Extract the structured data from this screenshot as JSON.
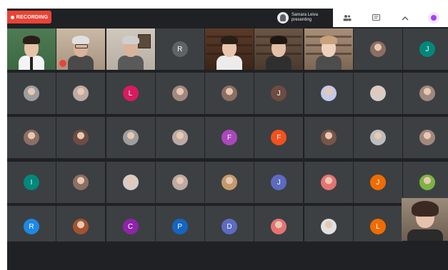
{
  "recording": {
    "label": "RECORDING",
    "color": "#ea4335"
  },
  "presenter": {
    "name": "Samara Leiva",
    "subtitle": "presenting"
  },
  "controls": [
    {
      "icon": "people-icon",
      "glyph": "👥"
    },
    {
      "icon": "chat-icon",
      "glyph": "▤"
    },
    {
      "icon": "chevron-up-icon",
      "glyph": "^"
    },
    {
      "icon": "activities-icon",
      "glyph": ""
    }
  ],
  "grid": {
    "rows": [
      [
        {
          "kind": "video",
          "scene": "green-wall-man"
        },
        {
          "kind": "video",
          "scene": "bookshelf-older-man",
          "muted": true
        },
        {
          "kind": "video",
          "scene": "older-man-wall"
        },
        {
          "kind": "avatar",
          "letter": "R",
          "color": "#5f6368"
        },
        {
          "kind": "video",
          "scene": "bookshelf-man"
        },
        {
          "kind": "video",
          "scene": "woman-bookshelf"
        },
        {
          "kind": "video",
          "scene": "young-man-shelf"
        },
        {
          "kind": "avatar",
          "letter": "",
          "color": "#8d6e63",
          "photo": true
        },
        {
          "kind": "avatar",
          "letter": "J",
          "color": "#00897b"
        }
      ],
      [
        {
          "kind": "avatar",
          "letter": "",
          "color": "#9e9e9e",
          "photo": true
        },
        {
          "kind": "avatar",
          "letter": "",
          "color": "#bcaaa4",
          "photo": true
        },
        {
          "kind": "avatar",
          "letter": "L",
          "color": "#d81b60"
        },
        {
          "kind": "avatar",
          "letter": "",
          "color": "#a1887f",
          "photo": true
        },
        {
          "kind": "avatar",
          "letter": "",
          "color": "#8d6e63",
          "photo": true
        },
        {
          "kind": "avatar",
          "letter": "J",
          "color": "#6d4c41"
        },
        {
          "kind": "avatar",
          "letter": "",
          "color": "#c5cae9",
          "photo": true
        },
        {
          "kind": "avatar",
          "letter": "",
          "color": "#d7ccc8",
          "photo": true
        },
        {
          "kind": "avatar",
          "letter": "",
          "color": "#a1887f",
          "photo": true
        }
      ],
      [
        {
          "kind": "avatar",
          "letter": "",
          "color": "#8d6e63",
          "photo": true
        },
        {
          "kind": "avatar",
          "letter": "",
          "color": "#6d4c41",
          "photo": true
        },
        {
          "kind": "avatar",
          "letter": "",
          "color": "#9e9e9e",
          "photo": true
        },
        {
          "kind": "avatar",
          "letter": "",
          "color": "#bcaaa4",
          "photo": true
        },
        {
          "kind": "avatar",
          "letter": "F",
          "color": "#ab47bc"
        },
        {
          "kind": "avatar",
          "letter": "F",
          "color": "#f4511e"
        },
        {
          "kind": "avatar",
          "letter": "",
          "color": "#795548",
          "photo": true
        },
        {
          "kind": "avatar",
          "letter": "",
          "color": "#bdbdbd",
          "photo": true
        },
        {
          "kind": "avatar",
          "letter": "",
          "color": "#a1887f",
          "photo": true
        }
      ],
      [
        {
          "kind": "avatar",
          "letter": "I",
          "color": "#00897b"
        },
        {
          "kind": "avatar",
          "letter": "",
          "color": "#8d6e63",
          "photo": true
        },
        {
          "kind": "avatar",
          "letter": "",
          "color": "#d7ccc8",
          "photo": true
        },
        {
          "kind": "avatar",
          "letter": "",
          "color": "#bcaaa4",
          "photo": true
        },
        {
          "kind": "avatar",
          "letter": "",
          "color": "#c49a6c",
          "photo": true
        },
        {
          "kind": "avatar",
          "letter": "J",
          "color": "#5c6bc0"
        },
        {
          "kind": "avatar",
          "letter": "",
          "color": "#e57373",
          "photo": true
        },
        {
          "kind": "avatar",
          "letter": "J",
          "color": "#ef6c00"
        },
        {
          "kind": "avatar",
          "letter": "",
          "color": "#7cb342",
          "photo": true
        }
      ],
      [
        {
          "kind": "avatar",
          "letter": "R",
          "color": "#1e88e5"
        },
        {
          "kind": "avatar",
          "letter": "",
          "color": "#a1532f",
          "photo": true
        },
        {
          "kind": "avatar",
          "letter": "C",
          "color": "#8e24aa"
        },
        {
          "kind": "avatar",
          "letter": "P",
          "color": "#1565c0"
        },
        {
          "kind": "avatar",
          "letter": "D",
          "color": "#5c6bc0"
        },
        {
          "kind": "avatar",
          "letter": "",
          "color": "#e57373",
          "photo": true
        },
        {
          "kind": "avatar",
          "letter": "",
          "color": "#e0e0e0",
          "photo": true
        },
        {
          "kind": "avatar",
          "letter": "L",
          "color": "#ef6c00"
        }
      ]
    ]
  },
  "self_view": {
    "scene": "self-video"
  }
}
